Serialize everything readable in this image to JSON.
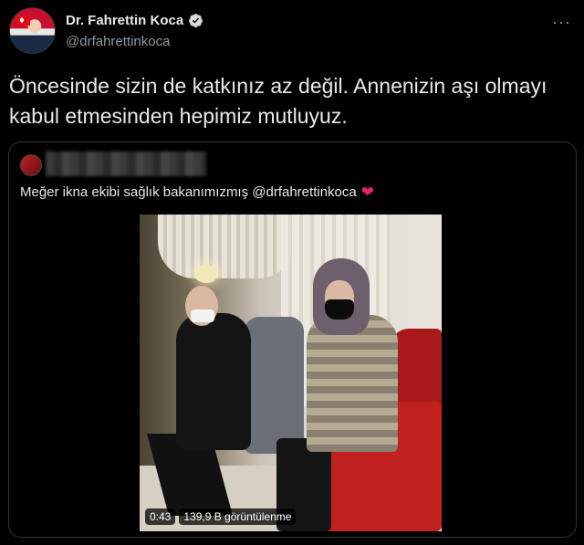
{
  "author": {
    "name": "Dr. Fahrettin Koca",
    "handle": "@drfahrettinkoca",
    "verified": true
  },
  "more_menu": "···",
  "tweet_text": "Öncesinde sizin de katkınız az değil. Annenizin aşı olmayı kabul etmesinden hepimiz mutluyuz.",
  "quoted_tweet": {
    "text": "Meğer ikna ekibi sağlık bakanımızmış @drfahrettinkoca",
    "emoji": "❤",
    "video": {
      "duration": "0:43",
      "views": "139,9 B görüntülenme"
    }
  },
  "colors": {
    "background": "#000000",
    "text": "#e7e9ea",
    "secondary": "#8b98a5",
    "verified": "#1d9bf0",
    "heart": "#e0245e"
  }
}
